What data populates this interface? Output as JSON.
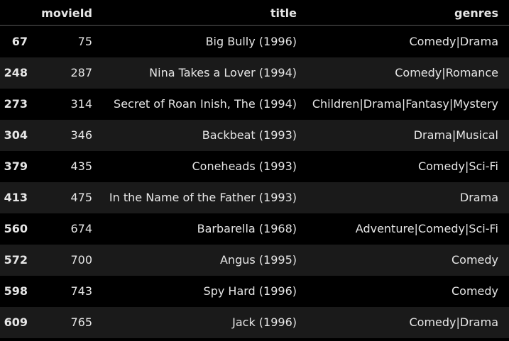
{
  "table": {
    "columns": [
      "",
      "movieId",
      "title",
      "genres"
    ],
    "rows": [
      {
        "index": "67",
        "movieId": "75",
        "title": "Big Bully (1996)",
        "genres": "Comedy|Drama"
      },
      {
        "index": "248",
        "movieId": "287",
        "title": "Nina Takes a Lover (1994)",
        "genres": "Comedy|Romance"
      },
      {
        "index": "273",
        "movieId": "314",
        "title": "Secret of Roan Inish, The (1994)",
        "genres": "Children|Drama|Fantasy|Mystery"
      },
      {
        "index": "304",
        "movieId": "346",
        "title": "Backbeat (1993)",
        "genres": "Drama|Musical"
      },
      {
        "index": "379",
        "movieId": "435",
        "title": "Coneheads (1993)",
        "genres": "Comedy|Sci-Fi"
      },
      {
        "index": "413",
        "movieId": "475",
        "title": "In the Name of the Father (1993)",
        "genres": "Drama"
      },
      {
        "index": "560",
        "movieId": "674",
        "title": "Barbarella (1968)",
        "genres": "Adventure|Comedy|Sci-Fi"
      },
      {
        "index": "572",
        "movieId": "700",
        "title": "Angus (1995)",
        "genres": "Comedy"
      },
      {
        "index": "598",
        "movieId": "743",
        "title": "Spy Hard (1996)",
        "genres": "Comedy"
      },
      {
        "index": "609",
        "movieId": "765",
        "title": "Jack (1996)",
        "genres": "Comedy|Drama"
      }
    ]
  },
  "colors": {
    "background": "#000000",
    "row_alt": "#1a1a1a",
    "text": "#e6e6e6",
    "header_rule": "#5a5a5a"
  }
}
